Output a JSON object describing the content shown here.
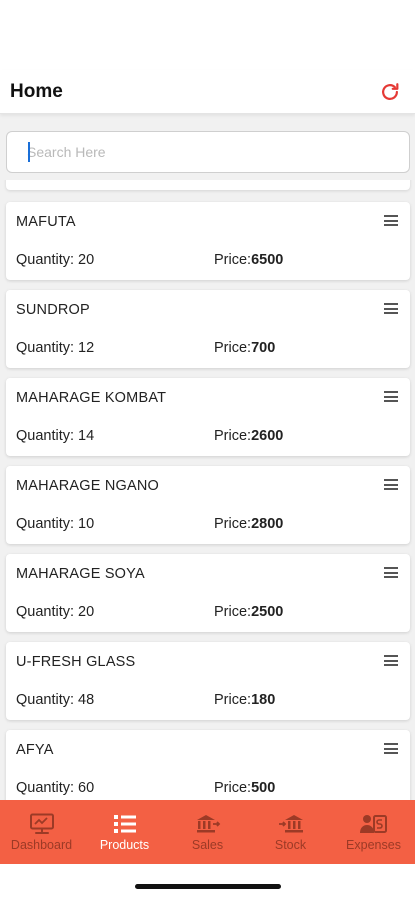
{
  "header": {
    "title": "Home",
    "refresh_icon": "refresh-icon"
  },
  "search": {
    "placeholder": "Search Here",
    "value": ""
  },
  "products": [
    {
      "name": "MAFUTA",
      "quantity_label": "Quantity: 20",
      "price_label": "Price:",
      "price": "6500"
    },
    {
      "name": "SUNDROP",
      "quantity_label": "Quantity: 12",
      "price_label": "Price:",
      "price": "700"
    },
    {
      "name": "MAHARAGE KOMBAT",
      "quantity_label": "Quantity: 14",
      "price_label": "Price:",
      "price": "2600"
    },
    {
      "name": "MAHARAGE NGANO",
      "quantity_label": "Quantity: 10",
      "price_label": "Price:",
      "price": "2800"
    },
    {
      "name": "MAHARAGE SOYA",
      "quantity_label": "Quantity: 20",
      "price_label": "Price:",
      "price": "2500"
    },
    {
      "name": "U-FRESH GLASS",
      "quantity_label": "Quantity: 48",
      "price_label": "Price:",
      "price": "180"
    },
    {
      "name": "AFYA",
      "quantity_label": "Quantity: 60",
      "price_label": "Price:",
      "price": "500"
    }
  ],
  "nav": {
    "items": [
      {
        "label": "Dashboard",
        "icon": "monitor-icon"
      },
      {
        "label": "Products",
        "icon": "list-icon"
      },
      {
        "label": "Sales",
        "icon": "bank-icon"
      },
      {
        "label": "Stock",
        "icon": "bank-icon"
      },
      {
        "label": "Expenses",
        "icon": "person-money-icon"
      }
    ],
    "active": "Products"
  },
  "colors": {
    "accent": "#f36044",
    "refresh": "#e53935",
    "nav_inactive": "#9c3a26"
  }
}
